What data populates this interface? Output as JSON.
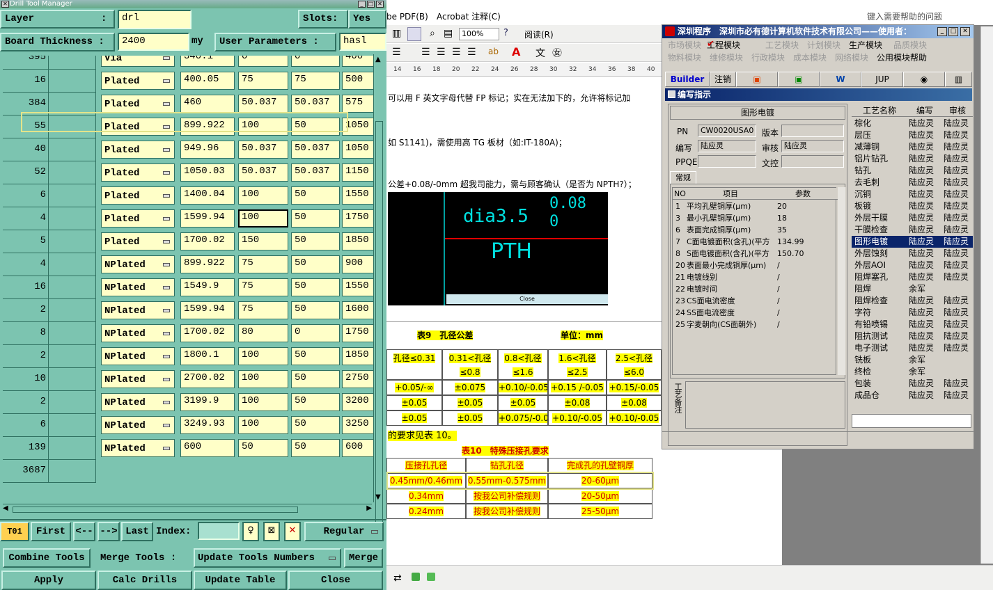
{
  "drill": {
    "title": "Drill Tool Manager",
    "layer_label": "Layer",
    "layer_dropdown": ":",
    "layer_value": "drl",
    "slots_label": "Slots:",
    "slots_value": "Yes",
    "board_label": "Board Thickness :",
    "board_value": "2400",
    "board_unit": "my",
    "user_params_label": "User Parameters :",
    "user_params_value": "hasl",
    "rows": [
      {
        "num": "395",
        "type": "Via",
        "v1": "340.1",
        "v2": "0",
        "v3": "0",
        "v4": "400"
      },
      {
        "num": "16",
        "type": "Plated",
        "v1": "400.05",
        "v2": "75",
        "v3": "75",
        "v4": "500"
      },
      {
        "num": "384",
        "type": "Plated",
        "v1": "460",
        "v2": "50.037",
        "v3": "50.037",
        "v4": "575"
      },
      {
        "num": "55",
        "type": "Plated",
        "v1": "899.922",
        "v2": "100",
        "v3": "50",
        "v4": "1050"
      },
      {
        "num": "40",
        "type": "Plated",
        "v1": "949.96",
        "v2": "50.037",
        "v3": "50.037",
        "v4": "1050"
      },
      {
        "num": "52",
        "type": "Plated",
        "v1": "1050.03",
        "v2": "50.037",
        "v3": "50.037",
        "v4": "1150"
      },
      {
        "num": "6",
        "type": "Plated",
        "v1": "1400.04",
        "v2": "100",
        "v3": "50",
        "v4": "1550"
      },
      {
        "num": "4",
        "type": "Plated",
        "v1": "1599.94",
        "v2": "100",
        "v3": "50",
        "v4": "1750"
      },
      {
        "num": "5",
        "type": "Plated",
        "v1": "1700.02",
        "v2": "150",
        "v3": "50",
        "v4": "1850"
      },
      {
        "num": "4",
        "type": "NPlated",
        "v1": "899.922",
        "v2": "75",
        "v3": "50",
        "v4": "900"
      },
      {
        "num": "16",
        "type": "NPlated",
        "v1": "1549.9",
        "v2": "75",
        "v3": "50",
        "v4": "1550"
      },
      {
        "num": "2",
        "type": "NPlated",
        "v1": "1599.94",
        "v2": "75",
        "v3": "50",
        "v4": "1600"
      },
      {
        "num": "8",
        "type": "NPlated",
        "v1": "1700.02",
        "v2": "80",
        "v3": "0",
        "v4": "1750"
      },
      {
        "num": "2",
        "type": "NPlated",
        "v1": "1800.1",
        "v2": "100",
        "v3": "50",
        "v4": "1850"
      },
      {
        "num": "10",
        "type": "NPlated",
        "v1": "2700.02",
        "v2": "100",
        "v3": "50",
        "v4": "2750"
      },
      {
        "num": "2",
        "type": "NPlated",
        "v1": "3199.9",
        "v2": "100",
        "v3": "50",
        "v4": "3200"
      },
      {
        "num": "6",
        "type": "NPlated",
        "v1": "3249.93",
        "v2": "100",
        "v3": "50",
        "v4": "3250"
      },
      {
        "num": "139",
        "type": "NPlated",
        "v1": "600",
        "v2": "50",
        "v3": "50",
        "v4": "600"
      }
    ],
    "total": "3687",
    "nav": {
      "tool": "T01",
      "first": "First",
      "prev": "<--",
      "next": "-->",
      "last": "Last",
      "index_label": "Index:",
      "regular": "Regular"
    },
    "actions": {
      "combine": "Combine Tools",
      "merge_label": "Merge Tools :",
      "update_numbers": "Update Tools Numbers",
      "merge": "Merge",
      "apply": "Apply",
      "calc": "Calc Drills",
      "update_table": "Update Table",
      "close": "Close"
    },
    "colors": {
      "panel": "#7cc4b0",
      "field": "#ffffc8"
    }
  },
  "doc": {
    "menu_pdf": "be PDF(B)",
    "menu_acrobat": "Acrobat 注释(C)",
    "help_placeholder": "键入需要帮助的问题",
    "zoom": "100%",
    "read_btn": "阅读(R)",
    "ruler": [
      "14",
      "16",
      "18",
      "20",
      "22",
      "24",
      "26",
      "28",
      "30",
      "32",
      "34",
      "36",
      "38",
      "40"
    ],
    "line1": "可以用 F 英文字母代替 FP 标记；实在无法加下的，允许将标记加",
    "line2": "如 S1141)，需使用高 TG 板材（如:IT-180A)；",
    "line3": "公差+0.08/-0mm 超我司能力，需与顾客确认（是否为 NPTH?）；",
    "img_dia": "dia3.5",
    "img_tol_top": "0.08",
    "img_tol_bot": "0",
    "img_pth": "PTH",
    "img_close": "Close",
    "table9_title": "表9　孔径公差",
    "table9_unit": "单位：mm",
    "table9_headers": [
      "孔径≤0.31",
      "0.31<孔径≤0.8",
      "0.8<孔径≤1.6",
      "1.6<孔径≤2.5",
      "2.5<孔径≤6.0"
    ],
    "table9_rows": [
      [
        "+0.05/-∞",
        "±0.075",
        "+0.10/-0.05",
        "+0.15 /-0.05",
        "+0.15/-0.05"
      ],
      [
        "±0.05",
        "±0.05",
        "±0.05",
        "±0.08",
        "±0.08"
      ],
      [
        "±0.05",
        "±0.05",
        "+0.075/-0.05",
        "+0.10/-0.05",
        "+0.10/-0.05"
      ]
    ],
    "line4": "的要求见表 10。",
    "table10_title": "表10　特殊压接孔要求",
    "table10_headers": [
      "压接孔孔径",
      "钻孔孔径",
      "完成孔的孔壁铜厚"
    ],
    "table10_rows": [
      [
        "0.45mm/0.46mm",
        "0.55mm-0.575mm",
        "20-60μm"
      ],
      [
        "0.34mm",
        "按我公司补偿规则",
        "20-50μm"
      ],
      [
        "0.24mm",
        "按我公司补偿规则",
        "25-50μm"
      ]
    ]
  },
  "app": {
    "title": "深圳程序　深圳市必有德计算机软件技术有限公司——使用者：",
    "menus_row1": [
      {
        "label": "市场模块",
        "on": false
      },
      {
        "label": "工程模块",
        "on": true
      },
      {
        "label": "工艺模块",
        "on": false
      },
      {
        "label": "计划模块",
        "on": false
      },
      {
        "label": "生产模块",
        "on": true
      },
      {
        "label": "品质模块",
        "on": false
      }
    ],
    "menus_row2": [
      {
        "label": "物料模块",
        "on": false
      },
      {
        "label": "维修模块",
        "on": false
      },
      {
        "label": "行政模块",
        "on": false
      },
      {
        "label": "成本模块",
        "on": false
      },
      {
        "label": "网络模块",
        "on": false
      },
      {
        "label": "公用模块",
        "on": true
      },
      {
        "label": "帮助",
        "on": true
      }
    ],
    "toolbar": {
      "builder": "Builder",
      "logout": "注销",
      "jup": "JUP"
    },
    "subtitle": "编写指示",
    "section": "图形电镀",
    "pn_label": "PN",
    "pn_value": "CW0020USA0",
    "version_label": "版本",
    "version_value": "",
    "writer_label": "编写",
    "writer_value": "陆应灵",
    "review_label": "审核",
    "review_value": "陆应灵",
    "ppqe_label": "PPQE",
    "ppqe_value": "",
    "doc_label": "文控",
    "doc_value": "",
    "tab_general": "常规",
    "param_headers": {
      "no": "NO",
      "item": "项目",
      "param": "参数"
    },
    "params": [
      {
        "no": "1",
        "item": "平均孔壁铜厚(μm)",
        "val": "20"
      },
      {
        "no": "3",
        "item": "最小孔壁铜厚(μm)",
        "val": "18"
      },
      {
        "no": "6",
        "item": "表面完成铜厚(μm)",
        "val": "35"
      },
      {
        "no": "7",
        "item": "C面电镀面积(含孔)(平方",
        "val": "134.99"
      },
      {
        "no": "8",
        "item": "S面电镀面积(含孔)(平方",
        "val": "150.70"
      },
      {
        "no": "20",
        "item": "表面最小完成铜厚(μm)",
        "val": "/"
      },
      {
        "no": "21",
        "item": "电镀线别",
        "val": "/"
      },
      {
        "no": "22",
        "item": "电镀时间",
        "val": "/"
      },
      {
        "no": "23",
        "item": "CS面电流密度",
        "val": "/"
      },
      {
        "no": "24",
        "item": "SS面电流密度",
        "val": "/"
      },
      {
        "no": "25",
        "item": "字麦朝向(CS面朝外)",
        "val": "/"
      }
    ],
    "note_label": "工艺备注",
    "process_headers": {
      "name": "工艺名称",
      "writer": "编写",
      "review": "审核"
    },
    "processes": [
      {
        "name": "棕化",
        "w": "陆应灵",
        "r": "陆应灵",
        "sel": false
      },
      {
        "name": "层压",
        "w": "陆应灵",
        "r": "陆应灵",
        "sel": false
      },
      {
        "name": "减薄铜",
        "w": "陆应灵",
        "r": "陆应灵",
        "sel": false
      },
      {
        "name": "铝片钻孔",
        "w": "陆应灵",
        "r": "陆应灵",
        "sel": false
      },
      {
        "name": "钻孔",
        "w": "陆应灵",
        "r": "陆应灵",
        "sel": false
      },
      {
        "name": "去毛刺",
        "w": "陆应灵",
        "r": "陆应灵",
        "sel": false
      },
      {
        "name": "沉铜",
        "w": "陆应灵",
        "r": "陆应灵",
        "sel": false
      },
      {
        "name": "板镀",
        "w": "陆应灵",
        "r": "陆应灵",
        "sel": false
      },
      {
        "name": "外层干膜",
        "w": "陆应灵",
        "r": "陆应灵",
        "sel": false
      },
      {
        "name": "干膜检查",
        "w": "陆应灵",
        "r": "陆应灵",
        "sel": false
      },
      {
        "name": "图形电镀",
        "w": "陆应灵",
        "r": "陆应灵",
        "sel": true
      },
      {
        "name": "外层蚀刻",
        "w": "陆应灵",
        "r": "陆应灵",
        "sel": false
      },
      {
        "name": "外层AOI",
        "w": "陆应灵",
        "r": "陆应灵",
        "sel": false
      },
      {
        "name": "阻焊塞孔",
        "w": "陆应灵",
        "r": "陆应灵",
        "sel": false
      },
      {
        "name": "阻焊",
        "w": "余军",
        "r": "",
        "sel": false
      },
      {
        "name": "阻焊检查",
        "w": "陆应灵",
        "r": "陆应灵",
        "sel": false
      },
      {
        "name": "字符",
        "w": "陆应灵",
        "r": "陆应灵",
        "sel": false
      },
      {
        "name": "有铅喷锡",
        "w": "陆应灵",
        "r": "陆应灵",
        "sel": false
      },
      {
        "name": "阻抗测试",
        "w": "陆应灵",
        "r": "陆应灵",
        "sel": false
      },
      {
        "name": "电子测试",
        "w": "陆应灵",
        "r": "陆应灵",
        "sel": false
      },
      {
        "name": "铣板",
        "w": "余军",
        "r": "",
        "sel": false
      },
      {
        "name": "终检",
        "w": "余军",
        "r": "",
        "sel": false
      },
      {
        "name": "包装",
        "w": "陆应灵",
        "r": "陆应灵",
        "sel": false
      },
      {
        "name": "成品仓",
        "w": "陆应灵",
        "r": "陆应灵",
        "sel": false
      }
    ]
  }
}
